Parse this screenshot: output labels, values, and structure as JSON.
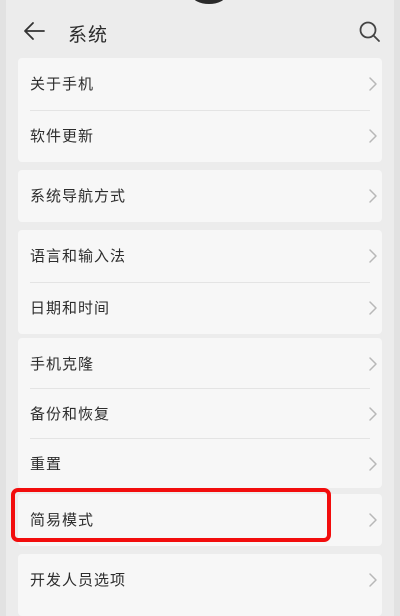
{
  "header": {
    "title": "系统",
    "back_icon": "arrow-left-icon",
    "search_icon": "search-icon"
  },
  "groups": [
    {
      "items": [
        {
          "label": "关于手机"
        },
        {
          "label": "软件更新"
        }
      ]
    },
    {
      "items": [
        {
          "label": "系统导航方式"
        }
      ]
    },
    {
      "items": [
        {
          "label": "语言和输入法"
        },
        {
          "label": "日期和时间"
        }
      ]
    },
    {
      "items": [
        {
          "label": "手机克隆"
        },
        {
          "label": "备份和恢复"
        },
        {
          "label": "重置"
        }
      ]
    },
    {
      "items": [
        {
          "label": "简易模式"
        }
      ]
    },
    {
      "items": [
        {
          "label": "开发人员选项"
        }
      ]
    }
  ],
  "annotation": {
    "highlighted_item": "简易模式",
    "color": "#f20d0d"
  },
  "colors": {
    "background": "#ececec",
    "card": "#f7f7f7",
    "text": "#2d2d2d",
    "chevron": "#b8b8b8"
  }
}
